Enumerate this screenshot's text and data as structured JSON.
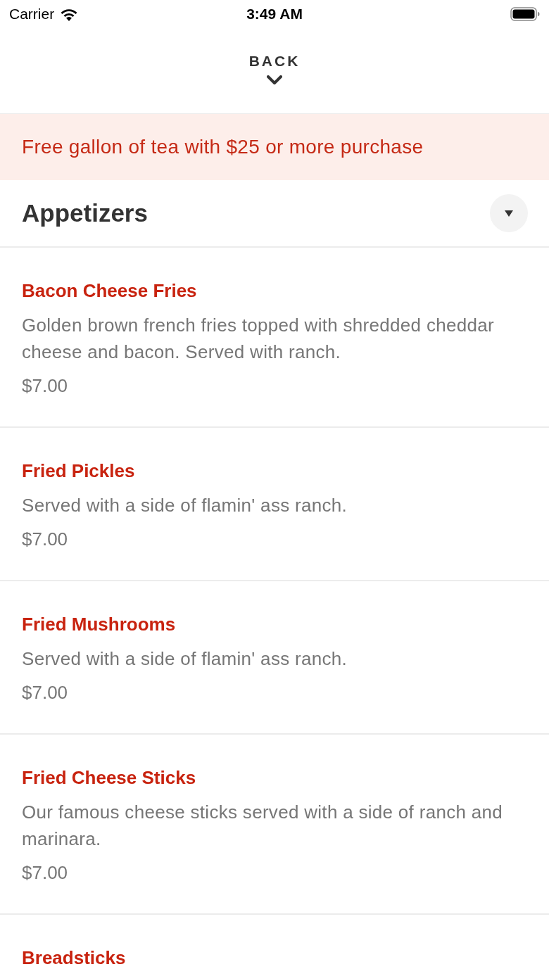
{
  "status_bar": {
    "carrier": "Carrier",
    "time": "3:49 AM"
  },
  "header": {
    "back_label": "BACK"
  },
  "promo_banner": {
    "text": "Free gallon of tea with $25 or more purchase"
  },
  "section": {
    "title": "Appetizers",
    "items": [
      {
        "name": "Bacon Cheese Fries",
        "description": "Golden brown french fries topped with shredded cheddar cheese and bacon. Served with ranch.",
        "price": "$7.00"
      },
      {
        "name": "Fried Pickles",
        "description": "Served with a side of flamin' ass ranch.",
        "price": "$7.00"
      },
      {
        "name": "Fried Mushrooms",
        "description": "Served with a side of flamin' ass ranch.",
        "price": "$7.00"
      },
      {
        "name": "Fried Cheese Sticks",
        "description": "Our famous cheese sticks served with a side of ranch and marinara.",
        "price": "$7.00"
      },
      {
        "name": "Breadsticks"
      }
    ]
  }
}
